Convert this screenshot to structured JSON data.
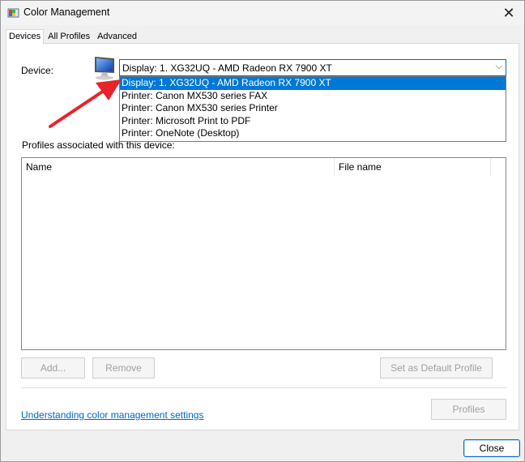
{
  "window": {
    "title": "Color Management",
    "app_icon": "color-management-icon",
    "close_glyph": "✕"
  },
  "tabs": [
    {
      "label": "Devices",
      "active": true
    },
    {
      "label": "All Profiles",
      "active": false
    },
    {
      "label": "Advanced",
      "active": false
    }
  ],
  "device": {
    "label": "Device:",
    "icon": "monitor-icon",
    "selected": "Display: 1. XG32UQ - AMD Radeon RX 7900 XT",
    "arrow_glyph": "⌵",
    "options": [
      "Display: 1. XG32UQ - AMD Radeon RX 7900 XT",
      "Printer: Canon MX530 series FAX",
      "Printer: Canon MX530 series Printer",
      "Printer: Microsoft Print to PDF",
      "Printer: OneNote (Desktop)"
    ]
  },
  "profiles": {
    "label": "Profiles associated with this device:",
    "columns": [
      "Name",
      "File name"
    ]
  },
  "buttons": {
    "add": "Add...",
    "remove": "Remove",
    "set_default": "Set as Default Profile",
    "profiles": "Profiles",
    "close": "Close"
  },
  "link_text": "Understanding color management settings",
  "colors": {
    "accent": "#0078d7",
    "link": "#0066cc",
    "annotation_arrow": "#e8232a"
  }
}
